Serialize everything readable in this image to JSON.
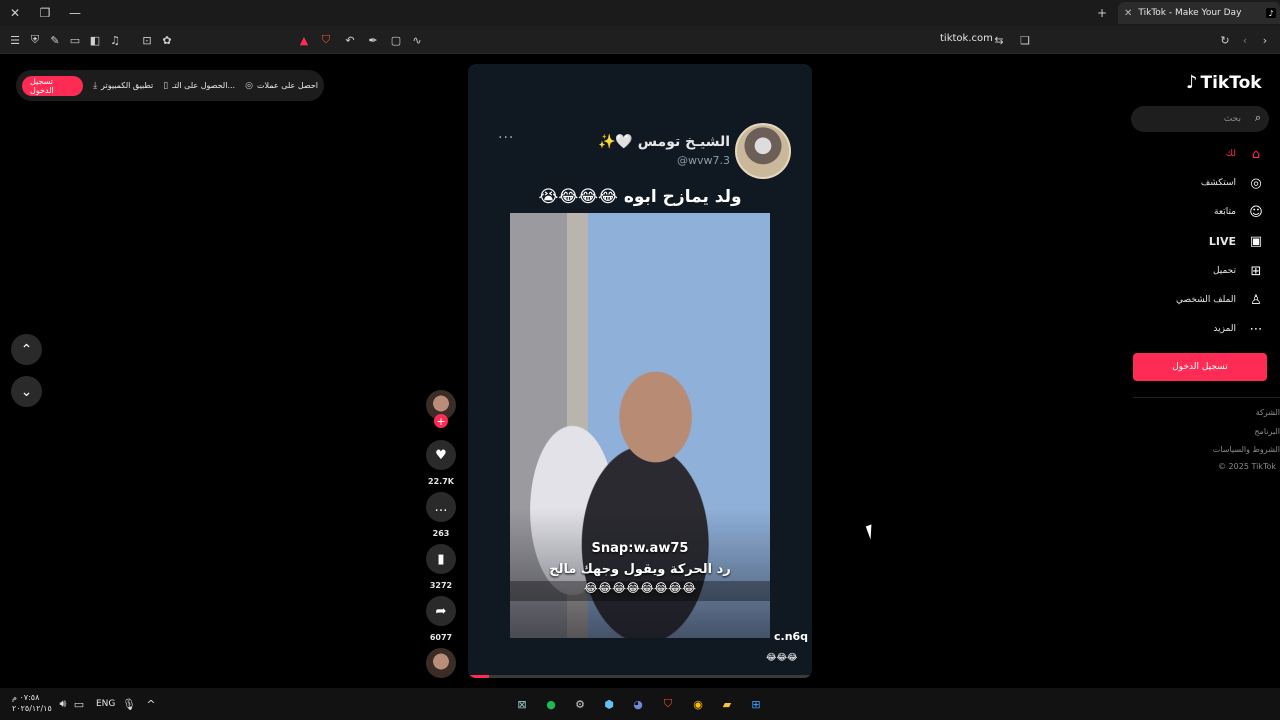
{
  "window": {
    "tab_title": "TikTok - Make Your Day",
    "url": "tiktok.com",
    "tab_close": "✕"
  },
  "topbar": {
    "signin": "تسجيل الدخول",
    "desktop_app": "تطبيق الكمبيوتر",
    "get_app": "الحصول على التـ...",
    "coins": "احصل على عملات"
  },
  "video": {
    "author_name": "الشيـخ تومس 🤍✨",
    "author_handle": "@wvw7.3",
    "more": "···",
    "caption": "ولد يمازح ابوه 😂😂😂😭",
    "overlay_snap": "Snap:w.aw75",
    "overlay_line": "رد الحركة ويقول وجهك مالح",
    "overlay_emojis": "😂😂😂😂😂😂😂😂",
    "watermark": "c.n6q",
    "bottom_emojis": "😂😂😂"
  },
  "actions": {
    "likes": "22.7K",
    "comments": "263",
    "saves": "3272",
    "shares": "6077"
  },
  "sidebar": {
    "logo": "TikTok",
    "search_placeholder": "بحث",
    "items": [
      {
        "label": "لك",
        "icon": "home-icon"
      },
      {
        "label": "استكشف",
        "icon": "compass-icon"
      },
      {
        "label": "متابَعة",
        "icon": "following-icon"
      },
      {
        "label": "LIVE",
        "icon": "live-icon"
      },
      {
        "label": "تحميل",
        "icon": "upload-icon"
      },
      {
        "label": "الملف الشخصي",
        "icon": "profile-icon"
      },
      {
        "label": "المزيد",
        "icon": "more-icon"
      }
    ],
    "login_button": "تسجيل الدخول",
    "footer": [
      "الشركة",
      "البرنامج",
      "الشروط والسياسات",
      "© 2025 TikTok"
    ]
  },
  "taskbar": {
    "time": "٠٧:٥٨ م",
    "date": "٢٠٢٥/١٢/١٥",
    "lang": "ENG"
  },
  "colors": {
    "accent": "#fe2c55",
    "background": "#000000",
    "card": "#101822"
  }
}
